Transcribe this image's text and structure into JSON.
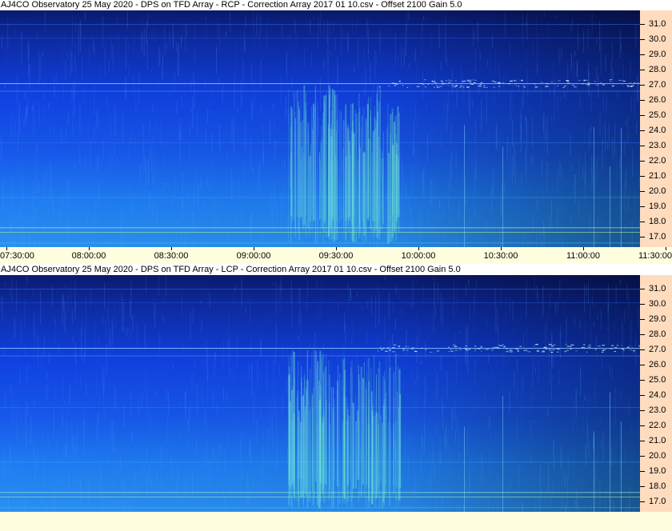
{
  "panels": [
    {
      "title": "AJ4CO Observatory 25 May 2020  -  DPS on TFD Array  -  RCP  -  Correction Array 2017 01 10.csv  -  Offset 2100  Gain 5.0",
      "polarization": "RCP"
    },
    {
      "title": "AJ4CO Observatory 25 May 2020  -  DPS on TFD Array  -  LCP  -  Correction Array 2017 01 10.csv  -  Offset 2100  Gain 5.0",
      "polarization": "LCP"
    }
  ],
  "y_axis": {
    "labels": [
      "31.0",
      "30.0",
      "29.0",
      "28.0",
      "27.0",
      "26.0",
      "25.0",
      "24.0",
      "23.0",
      "22.0",
      "21.0",
      "20.0",
      "19.0",
      "18.0",
      "17.0"
    ],
    "range_mhz": [
      16.3,
      31.9
    ]
  },
  "x_axis": {
    "labels": [
      "07:30:00",
      "08:00:00",
      "08:30:00",
      "09:00:00",
      "09:30:00",
      "10:00:00",
      "10:30:00",
      "11:00:00",
      "11:30:00"
    ]
  },
  "colors": {
    "spectrogram_dark": "#0a1a6e",
    "spectrogram_mid": "#1040e0",
    "spectrogram_light": "#1f7cf2",
    "burst": "#6fe6d6",
    "axis_bg": "#ffdcbe",
    "time_bg": "#ffffe0"
  }
}
